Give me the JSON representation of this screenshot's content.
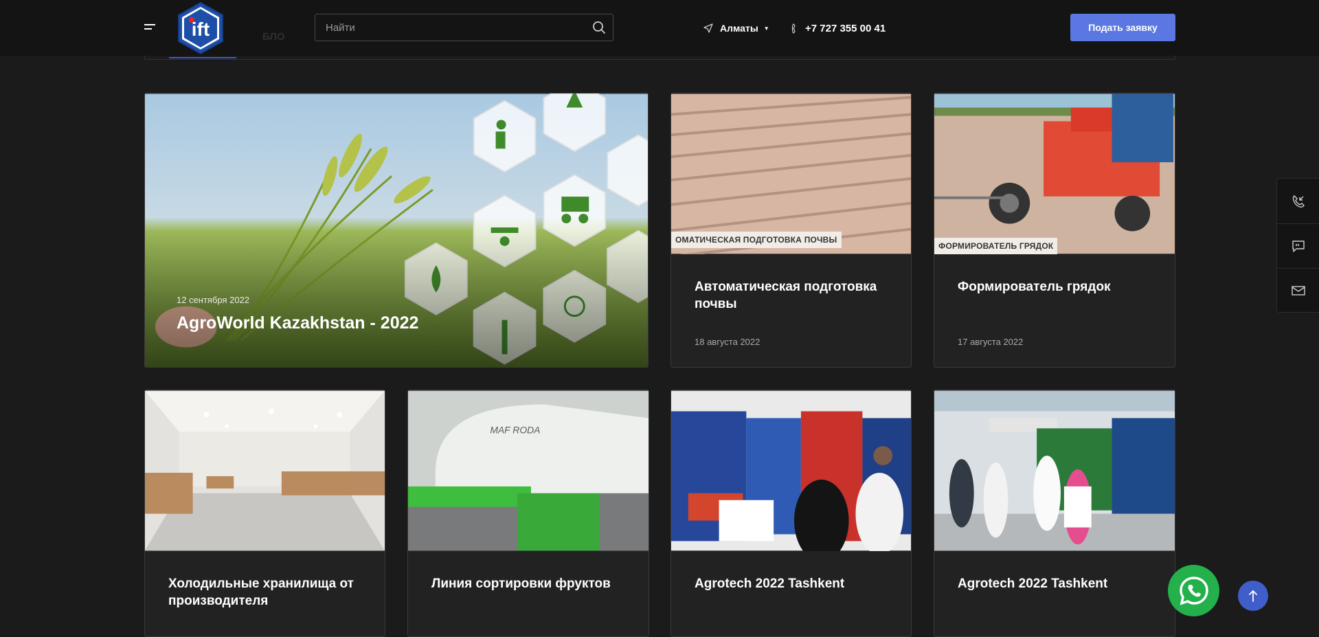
{
  "header": {
    "logo_text": "ift",
    "search_placeholder": "Найти",
    "city": "Алматы",
    "phone": "+7 727 355 00 41",
    "apply_label": "Подать заявку",
    "ghost_tab": "БЛО"
  },
  "colors": {
    "accent": "#5b78e2",
    "background": "#1b1b1b",
    "card": "#222222",
    "whatsapp": "#24b04b"
  },
  "featured": {
    "date": "12 сентября 2022",
    "title": "AgroWorld Kazakhstan - 2022"
  },
  "cards": [
    {
      "title": "Автоматическая подготовка почвы",
      "date": "18 августа 2022",
      "tag": "ОМАТИЧЕСКАЯ ПОДГОТОВКА ПОЧВЫ"
    },
    {
      "title": "Формирователь грядок",
      "date": "17 августа 2022",
      "tag": "ФОРМИРОВАТЕЛЬ ГРЯДОК"
    },
    {
      "title": "Холодильные хранилища от производителя",
      "date": ""
    },
    {
      "title": "Линия сортировки фруктов",
      "date": ""
    },
    {
      "title": "Agrotech 2022 Tashkent",
      "date": ""
    },
    {
      "title": "Agrotech 2022 Tashkent",
      "date": ""
    }
  ],
  "side_icons": [
    "phone-callback-icon",
    "chat-icon",
    "mail-icon"
  ],
  "floating": {
    "whatsapp_icon": "whatsapp-icon",
    "scroll_top_icon": "arrow-up-icon"
  }
}
